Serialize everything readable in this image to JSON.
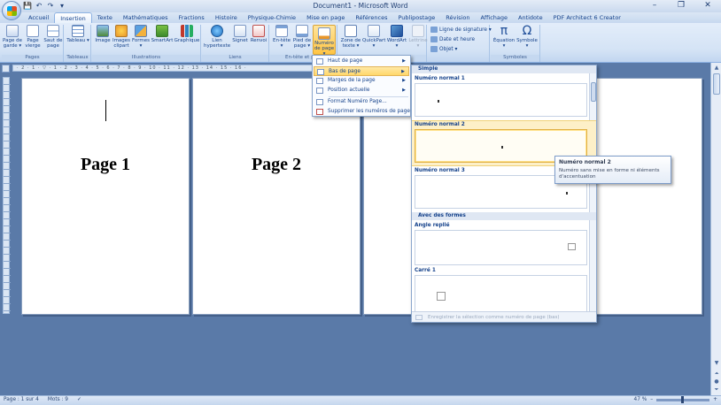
{
  "window": {
    "title": "Document1 - Microsoft Word",
    "qat": [
      "💾",
      "↶",
      "↷",
      "▾"
    ],
    "controls": [
      "–",
      "❐",
      "✕"
    ]
  },
  "tabs": [
    "Accueil",
    "Insertion",
    "Texte",
    "Mathématiques",
    "Fractions",
    "Histoire",
    "Physique-Chimie",
    "Mise en page",
    "Références",
    "Publipostage",
    "Révision",
    "Affichage",
    "Antidote",
    "PDF Architect 6 Creator"
  ],
  "ribbon": {
    "groups": {
      "pages": "Pages",
      "tableaux": "Tableaux",
      "illustrations": "Illustrations",
      "liens": "Liens",
      "entete": "En-tête et pied",
      "texte": "Texte",
      "symboles": "Symboles"
    },
    "buttons": {
      "page_garde": "Page de garde ▾",
      "page_vierge": "Page vierge",
      "saut_page": "Saut de page",
      "tableau": "Tableau ▾",
      "image": "Image",
      "images_clipart": "Images clipart",
      "formes": "Formes ▾",
      "smartart": "SmartArt",
      "graphique": "Graphique",
      "lien_hypertexte": "Lien hypertexte",
      "signet": "Signet",
      "renvoi": "Renvoi",
      "entete": "En-tête ▾",
      "pied_page": "Pied de page ▾",
      "numero_page": "Numéro de page ▾",
      "zone_texte": "Zone de texte ▾",
      "quickpart": "QuickPart ▾",
      "wordart": "WordArt ▾",
      "lettrine": "Lettrine ▾",
      "ligne_signature": "Ligne de signature ▾",
      "date_heure": "Date et heure",
      "objet": "Objet ▾",
      "equation": "Équation ▾",
      "symbole": "Symbole ▾"
    }
  },
  "ruler": {
    "horizontal": "· 2 · 1 · ▽ · 1 · 2 · 3 · 4 · 5 · 6 · 7 · 8 · 9 · 10 · 11 · 12 · 13 · 14 · 15 · 16 ·"
  },
  "pages": [
    {
      "title": "Page 1"
    },
    {
      "title": "Page 2"
    }
  ],
  "menu": {
    "items": [
      {
        "label": "Haut de page",
        "submenu": true
      },
      {
        "label": "Bas de page",
        "submenu": true
      },
      {
        "label": "Marges de la page",
        "submenu": true
      },
      {
        "label": "Position actuelle",
        "submenu": true
      },
      {
        "label": "Format Numéro Page...",
        "submenu": false
      },
      {
        "label": "Supprimer les numéros de page",
        "submenu": false
      }
    ]
  },
  "gallery": {
    "section_simple": "Simple",
    "section_formes": "Avec des formes",
    "items": [
      "Numéro normal 1",
      "Numéro normal 2",
      "Numéro normal 3",
      "Angle replié",
      "Carré 1"
    ],
    "footer": "Enregistrer la sélection comme numéro de page (bas)"
  },
  "tooltip": {
    "title": "Numéro normal 2",
    "description": "Numéro sans mise en forme ni éléments d'accentuation"
  },
  "status": {
    "page": "Page : 1 sur 4",
    "words": "Mots : 9",
    "zoom": "47 %"
  },
  "colors": {
    "accent": "#15428b",
    "highlight": "#ffd76a",
    "workspace": "#5a7aa8"
  }
}
